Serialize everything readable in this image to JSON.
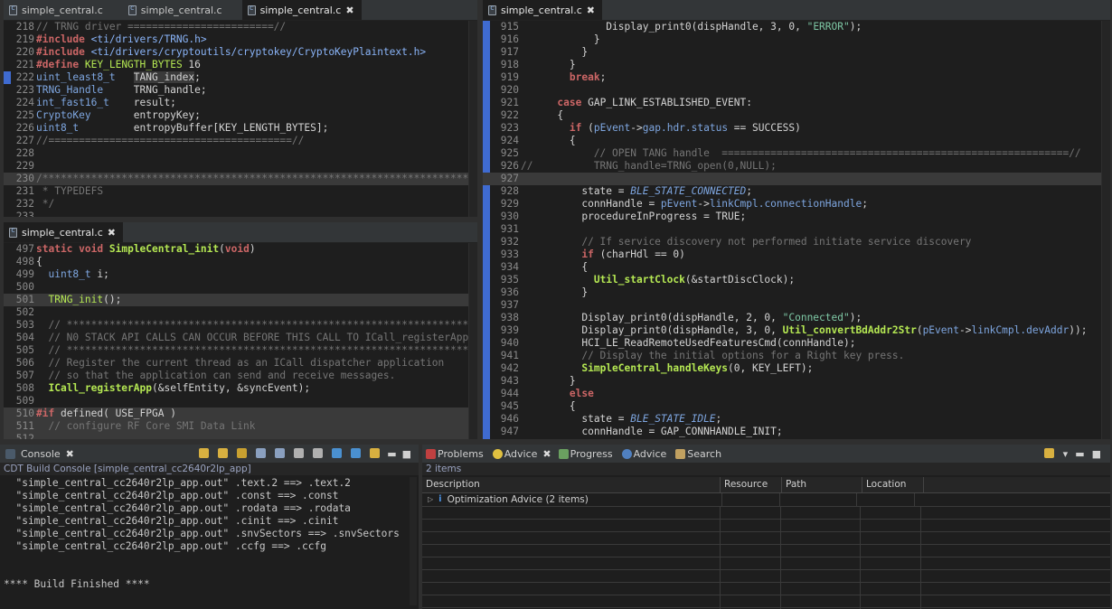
{
  "editor_top_left": {
    "tabs": [
      {
        "label": "simple_central.c",
        "active": false
      },
      {
        "label": "simple_central.c",
        "active": false
      },
      {
        "label": "simple_central.c",
        "active": true
      }
    ]
  },
  "editor_bottom_left": {
    "tabs": [
      {
        "label": "simple_central.c",
        "active": true
      }
    ]
  },
  "editor_right": {
    "tabs": [
      {
        "label": "simple_central.c",
        "active": true
      }
    ]
  },
  "console": {
    "tab_label": "Console",
    "subtitle": "CDT Build Console [simple_central_cc2640r2lp_app]",
    "lines": [
      "  \"simple_central_cc2640r2lp_app.out\" .text.2 ==> .text.2",
      "  \"simple_central_cc2640r2lp_app.out\" .const ==> .const",
      "  \"simple_central_cc2640r2lp_app.out\" .rodata ==> .rodata",
      "  \"simple_central_cc2640r2lp_app.out\" .cinit ==> .cinit",
      "  \"simple_central_cc2640r2lp_app.out\" .snvSectors ==> .snvSectors",
      "  \"simple_central_cc2640r2lp_app.out\" .ccfg ==> .ccfg",
      "",
      "",
      "**** Build Finished ****"
    ]
  },
  "problems": {
    "tabs": [
      "Problems",
      "Advice",
      "Progress",
      "Advice",
      "Search"
    ],
    "count": "2 items",
    "columns": [
      "Description",
      "Resource",
      "Path",
      "Location"
    ],
    "row": "Optimization Advice (2 items)"
  }
}
